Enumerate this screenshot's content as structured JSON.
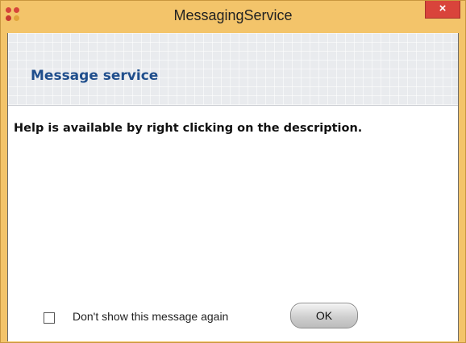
{
  "window": {
    "title": "MessagingService",
    "close_label": "×",
    "app_icon": "four-dots-app-icon",
    "title_bar_color": "#f3c46a",
    "close_color": "#d9443b"
  },
  "header": {
    "title": "Message service",
    "title_color": "#1f4e8c"
  },
  "body": {
    "message": "Help is available by right clicking on the description."
  },
  "footer": {
    "checkbox_label": "Don't show this message again",
    "checkbox_checked": false,
    "ok_label": "OK"
  }
}
